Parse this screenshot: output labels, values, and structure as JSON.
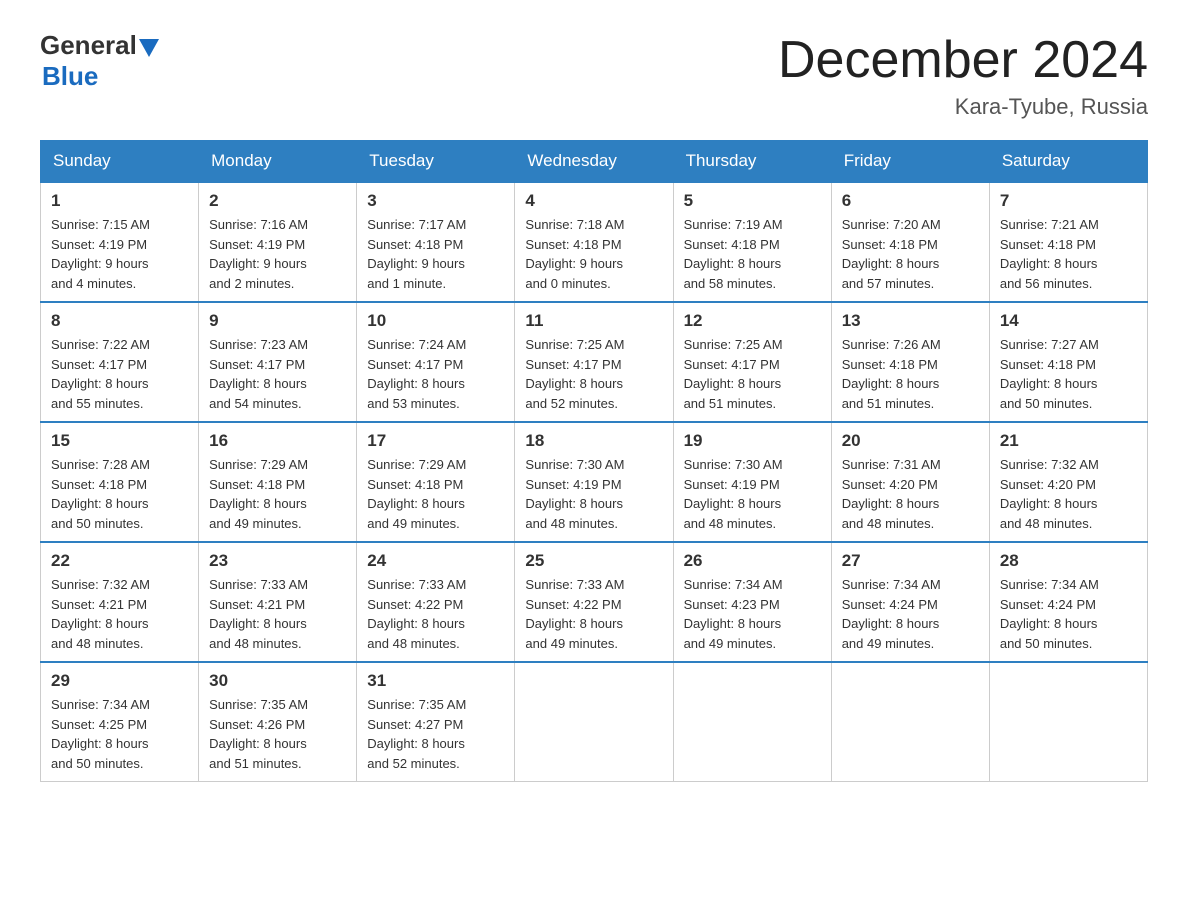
{
  "header": {
    "logo_general": "General",
    "logo_blue": "Blue",
    "month_title": "December 2024",
    "location": "Kara-Tyube, Russia"
  },
  "weekdays": [
    "Sunday",
    "Monday",
    "Tuesday",
    "Wednesday",
    "Thursday",
    "Friday",
    "Saturday"
  ],
  "weeks": [
    [
      {
        "day": "1",
        "sunrise": "7:15 AM",
        "sunset": "4:19 PM",
        "daylight": "9 hours and 4 minutes."
      },
      {
        "day": "2",
        "sunrise": "7:16 AM",
        "sunset": "4:19 PM",
        "daylight": "9 hours and 2 minutes."
      },
      {
        "day": "3",
        "sunrise": "7:17 AM",
        "sunset": "4:18 PM",
        "daylight": "9 hours and 1 minute."
      },
      {
        "day": "4",
        "sunrise": "7:18 AM",
        "sunset": "4:18 PM",
        "daylight": "9 hours and 0 minutes."
      },
      {
        "day": "5",
        "sunrise": "7:19 AM",
        "sunset": "4:18 PM",
        "daylight": "8 hours and 58 minutes."
      },
      {
        "day": "6",
        "sunrise": "7:20 AM",
        "sunset": "4:18 PM",
        "daylight": "8 hours and 57 minutes."
      },
      {
        "day": "7",
        "sunrise": "7:21 AM",
        "sunset": "4:18 PM",
        "daylight": "8 hours and 56 minutes."
      }
    ],
    [
      {
        "day": "8",
        "sunrise": "7:22 AM",
        "sunset": "4:17 PM",
        "daylight": "8 hours and 55 minutes."
      },
      {
        "day": "9",
        "sunrise": "7:23 AM",
        "sunset": "4:17 PM",
        "daylight": "8 hours and 54 minutes."
      },
      {
        "day": "10",
        "sunrise": "7:24 AM",
        "sunset": "4:17 PM",
        "daylight": "8 hours and 53 minutes."
      },
      {
        "day": "11",
        "sunrise": "7:25 AM",
        "sunset": "4:17 PM",
        "daylight": "8 hours and 52 minutes."
      },
      {
        "day": "12",
        "sunrise": "7:25 AM",
        "sunset": "4:17 PM",
        "daylight": "8 hours and 51 minutes."
      },
      {
        "day": "13",
        "sunrise": "7:26 AM",
        "sunset": "4:18 PM",
        "daylight": "8 hours and 51 minutes."
      },
      {
        "day": "14",
        "sunrise": "7:27 AM",
        "sunset": "4:18 PM",
        "daylight": "8 hours and 50 minutes."
      }
    ],
    [
      {
        "day": "15",
        "sunrise": "7:28 AM",
        "sunset": "4:18 PM",
        "daylight": "8 hours and 50 minutes."
      },
      {
        "day": "16",
        "sunrise": "7:29 AM",
        "sunset": "4:18 PM",
        "daylight": "8 hours and 49 minutes."
      },
      {
        "day": "17",
        "sunrise": "7:29 AM",
        "sunset": "4:18 PM",
        "daylight": "8 hours and 49 minutes."
      },
      {
        "day": "18",
        "sunrise": "7:30 AM",
        "sunset": "4:19 PM",
        "daylight": "8 hours and 48 minutes."
      },
      {
        "day": "19",
        "sunrise": "7:30 AM",
        "sunset": "4:19 PM",
        "daylight": "8 hours and 48 minutes."
      },
      {
        "day": "20",
        "sunrise": "7:31 AM",
        "sunset": "4:20 PM",
        "daylight": "8 hours and 48 minutes."
      },
      {
        "day": "21",
        "sunrise": "7:32 AM",
        "sunset": "4:20 PM",
        "daylight": "8 hours and 48 minutes."
      }
    ],
    [
      {
        "day": "22",
        "sunrise": "7:32 AM",
        "sunset": "4:21 PM",
        "daylight": "8 hours and 48 minutes."
      },
      {
        "day": "23",
        "sunrise": "7:33 AM",
        "sunset": "4:21 PM",
        "daylight": "8 hours and 48 minutes."
      },
      {
        "day": "24",
        "sunrise": "7:33 AM",
        "sunset": "4:22 PM",
        "daylight": "8 hours and 48 minutes."
      },
      {
        "day": "25",
        "sunrise": "7:33 AM",
        "sunset": "4:22 PM",
        "daylight": "8 hours and 49 minutes."
      },
      {
        "day": "26",
        "sunrise": "7:34 AM",
        "sunset": "4:23 PM",
        "daylight": "8 hours and 49 minutes."
      },
      {
        "day": "27",
        "sunrise": "7:34 AM",
        "sunset": "4:24 PM",
        "daylight": "8 hours and 49 minutes."
      },
      {
        "day": "28",
        "sunrise": "7:34 AM",
        "sunset": "4:24 PM",
        "daylight": "8 hours and 50 minutes."
      }
    ],
    [
      {
        "day": "29",
        "sunrise": "7:34 AM",
        "sunset": "4:25 PM",
        "daylight": "8 hours and 50 minutes."
      },
      {
        "day": "30",
        "sunrise": "7:35 AM",
        "sunset": "4:26 PM",
        "daylight": "8 hours and 51 minutes."
      },
      {
        "day": "31",
        "sunrise": "7:35 AM",
        "sunset": "4:27 PM",
        "daylight": "8 hours and 52 minutes."
      },
      null,
      null,
      null,
      null
    ]
  ]
}
